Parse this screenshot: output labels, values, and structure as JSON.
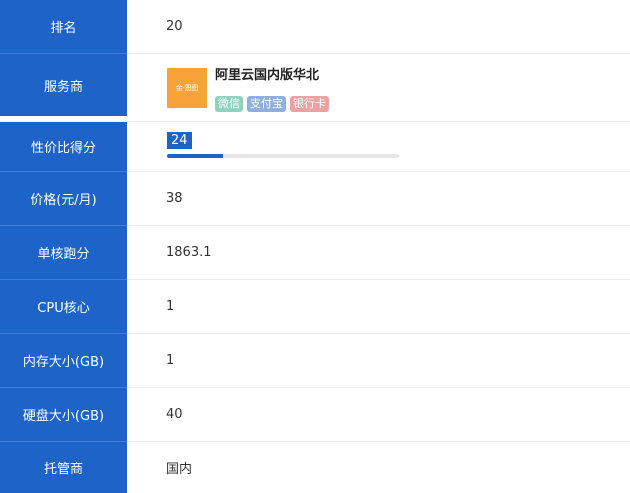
{
  "rows": {
    "rank": {
      "label": "排名",
      "value": "20"
    },
    "provider": {
      "label": "服务商",
      "name": "阿里云国内版华北",
      "logo_text": "金·恩图",
      "payments": [
        "微信",
        "支付宝",
        "银行卡"
      ]
    },
    "score": {
      "label": "性价比得分",
      "value": "24",
      "progress_fraction": 0.24
    },
    "price": {
      "label": "价格(元/月)",
      "value": "38"
    },
    "single_core": {
      "label": "单核跑分",
      "value": "1863.1"
    },
    "cpu": {
      "label": "CPU核心",
      "value": "1"
    },
    "memory": {
      "label": "内存大小(GB)",
      "value": "1"
    },
    "disk": {
      "label": "硬盘大小(GB)",
      "value": "40"
    },
    "host": {
      "label": "托管商",
      "value": "国内"
    }
  },
  "colors": {
    "label_bg": "#1e64c8",
    "accent": "#1e64c8",
    "tag_wechat": "#8fd3bf",
    "tag_alipay": "#8fb0de",
    "tag_card": "#eaa2a2",
    "logo_bg": "#f7a33a"
  }
}
